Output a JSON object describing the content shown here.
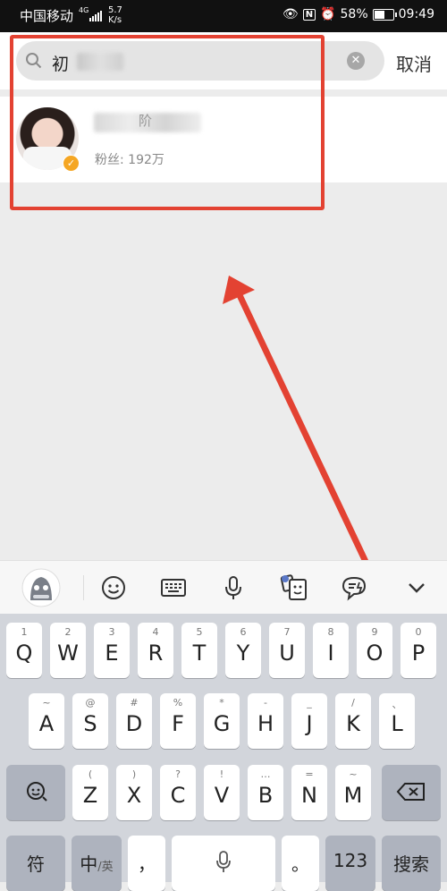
{
  "status_bar": {
    "carrier": "中国移动",
    "network": "4G",
    "speed": "5.7\nK/s",
    "battery_percent": "58%",
    "battery_level": 0.58,
    "time": "09:49"
  },
  "search": {
    "query": "初",
    "cancel_label": "取消"
  },
  "result": {
    "name_fragment": "阶",
    "followers": "粉丝: 192万",
    "verified": true
  },
  "toolbar": {
    "icons": [
      "assistant-mascot-icon",
      "emoji-icon",
      "keyboard-icon",
      "microphone-icon",
      "sticker-icon",
      "voice-bubble-icon",
      "chevron-down-icon"
    ]
  },
  "keyboard": {
    "row1": [
      {
        "sub": "1",
        "key": "Q"
      },
      {
        "sub": "2",
        "key": "W"
      },
      {
        "sub": "3",
        "key": "E"
      },
      {
        "sub": "4",
        "key": "R"
      },
      {
        "sub": "5",
        "key": "T"
      },
      {
        "sub": "6",
        "key": "Y"
      },
      {
        "sub": "7",
        "key": "U"
      },
      {
        "sub": "8",
        "key": "I"
      },
      {
        "sub": "9",
        "key": "O"
      },
      {
        "sub": "0",
        "key": "P"
      }
    ],
    "row2": [
      {
        "sub": "~",
        "key": "A"
      },
      {
        "sub": "@",
        "key": "S"
      },
      {
        "sub": "#",
        "key": "D"
      },
      {
        "sub": "%",
        "key": "F"
      },
      {
        "sub": "*",
        "key": "G"
      },
      {
        "sub": "-",
        "key": "H"
      },
      {
        "sub": "_",
        "key": "J"
      },
      {
        "sub": "/",
        "key": "K"
      },
      {
        "sub": "、",
        "key": "L"
      }
    ],
    "row3": [
      {
        "sub": "(",
        "key": "Z"
      },
      {
        "sub": ")",
        "key": "X"
      },
      {
        "sub": "?",
        "key": "C"
      },
      {
        "sub": "!",
        "key": "V"
      },
      {
        "sub": "…",
        "key": "B"
      },
      {
        "sub": "=",
        "key": "N"
      },
      {
        "sub": "~",
        "key": "M"
      }
    ],
    "symbols_label": "符",
    "lang_label": "中",
    "lang_alt_label": "/英",
    "comma_label": "，",
    "period_label": "。",
    "numbers_label": "123",
    "search_label": "搜索"
  },
  "colors": {
    "annotation_red": "#e34232",
    "verified_badge": "#f5a623"
  }
}
